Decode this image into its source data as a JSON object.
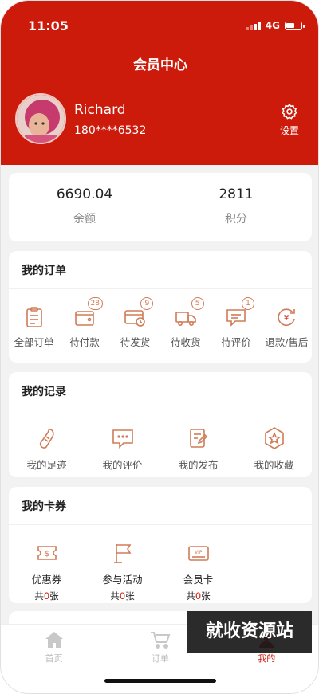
{
  "status_bar": {
    "time": "11:05",
    "network": "4G"
  },
  "header": {
    "title": "会员中心",
    "user_name": "Richard",
    "user_phone": "180****6532",
    "settings_label": "设置"
  },
  "stats": {
    "balance_value": "6690.04",
    "balance_label": "余额",
    "points_value": "2811",
    "points_label": "积分"
  },
  "orders": {
    "title": "我的订单",
    "items": [
      {
        "label": "全部订单",
        "icon": "clipboard-icon"
      },
      {
        "label": "待付款",
        "icon": "wallet-icon",
        "badge": "28"
      },
      {
        "label": "待发货",
        "icon": "card-icon",
        "badge": "9"
      },
      {
        "label": "待收货",
        "icon": "truck-icon",
        "badge": "5"
      },
      {
        "label": "待评价",
        "icon": "comment-icon",
        "badge": "1"
      },
      {
        "label": "退款/售后",
        "icon": "refund-icon"
      }
    ]
  },
  "records": {
    "title": "我的记录",
    "items": [
      {
        "label": "我的足迹",
        "icon": "footprint-icon"
      },
      {
        "label": "我的评价",
        "icon": "chat-icon"
      },
      {
        "label": "我的发布",
        "icon": "edit-doc-icon"
      },
      {
        "label": "我的收藏",
        "icon": "star-icon"
      }
    ]
  },
  "coupons": {
    "title": "我的卡券",
    "items": [
      {
        "label": "优惠券",
        "icon": "coupon-icon",
        "count_prefix": "共",
        "count": "0",
        "count_suffix": "张"
      },
      {
        "label": "参与活动",
        "icon": "flag-icon",
        "count_prefix": "共",
        "count": "0",
        "count_suffix": "张"
      },
      {
        "label": "会员卡",
        "icon": "vip-card-icon",
        "count_prefix": "共",
        "count": "0",
        "count_suffix": "张"
      }
    ]
  },
  "tabbar": {
    "items": [
      {
        "label": "首页",
        "icon": "home-icon"
      },
      {
        "label": "订单",
        "icon": "cart-icon"
      },
      {
        "label": "我的",
        "icon": "user-icon"
      }
    ]
  },
  "watermark": "就收资源站",
  "colors": {
    "primary": "#cc1a0b",
    "icon_accent": "#d07b57",
    "background": "#f2f2f2"
  }
}
